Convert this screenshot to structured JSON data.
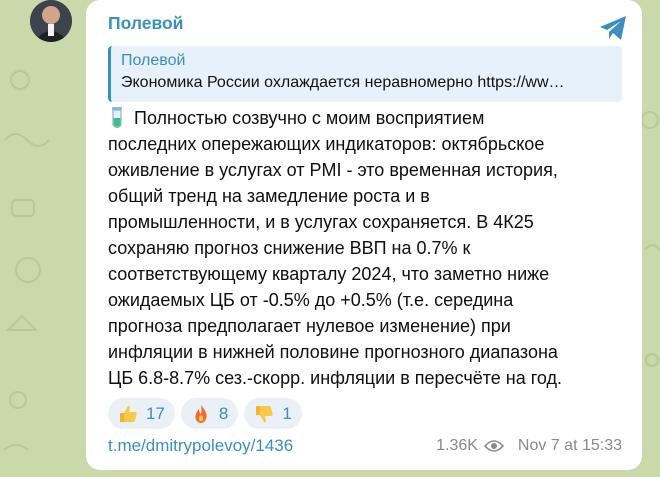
{
  "channel": {
    "name": "Полевой"
  },
  "reply": {
    "author": "Полевой",
    "text": "Экономика России охлаждается неравномерно https://ww…"
  },
  "message": {
    "lines": [
      "Полностью созвучно с моим восприятием",
      "последних опережающих индикаторов: октябрьское",
      "оживление в услугах от PMI - это временная история,",
      "общий тренд на замедление роста и в",
      "промышленности, и в услугах сохраняется. В 4К25",
      "сохраняю прогноз снижение ВВП на 0.7% к",
      "соответствующему кварталу 2024, что заметно ниже",
      "ожидаемых ЦБ от -0.5% до +0.5% (т.е. середина",
      "прогноза предполагает нулевое изменение) при",
      "инфляции в нижней половине прогнозного диапазона",
      "ЦБ 6.8-8.7% сез.-скорр. инфляции в пересчёте на год."
    ]
  },
  "reactions": [
    {
      "emoji": "thumbs-up",
      "count": "17"
    },
    {
      "emoji": "fire",
      "count": "8"
    },
    {
      "emoji": "thumbs-down",
      "count": "1"
    }
  ],
  "footer": {
    "link": "t.me/dmitrypolevoy/1436",
    "views": "1.36K",
    "date": "Nov 7 at 15:33"
  },
  "icons": {
    "share": "telegram-share-icon",
    "views": "eye-icon",
    "text_prefix": "test-tube-icon"
  },
  "colors": {
    "accent": "#3a8fc2",
    "wallpaper": "#c9d9a9",
    "reply_bg": "#e7f1f9"
  }
}
